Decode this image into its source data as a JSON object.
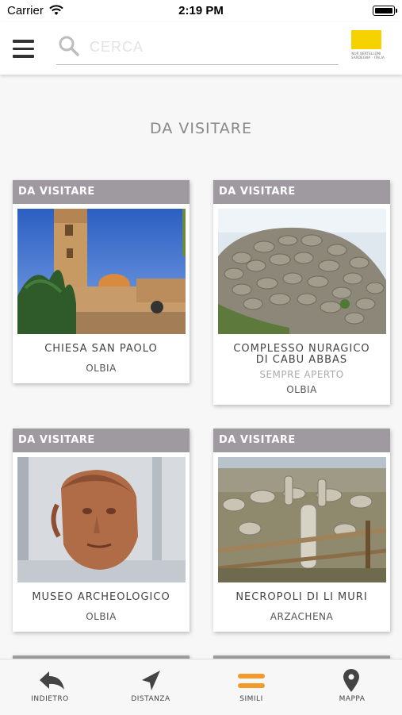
{
  "status_bar": {
    "carrier": "Carrier",
    "time": "2:19 PM"
  },
  "header": {
    "search_placeholder": "CERCA",
    "logo_line1": "NUR BERTELLONI",
    "logo_line2": "SARDEGNA · ITALIA"
  },
  "section_title": "DA VISITARE",
  "cards": [
    {
      "tag": "DA VISITARE",
      "name": "CHIESA SAN PAOLO",
      "hours": "",
      "location": "OLBIA"
    },
    {
      "tag": "DA VISITARE",
      "name": "COMPLESSO NURAGICO DI CABU ABBAS",
      "hours": "SEMPRE APERTO",
      "location": "OLBIA"
    },
    {
      "tag": "DA VISITARE",
      "name": "MUSEO ARCHEOLOGICO",
      "hours": "",
      "location": "OLBIA"
    },
    {
      "tag": "DA VISITARE",
      "name": "NECROPOLI DI LI MURI",
      "hours": "",
      "location": "ARZACHENA"
    }
  ],
  "bottom_nav": [
    {
      "label": "INDIETRO",
      "icon": "back-arrow-icon"
    },
    {
      "label": "DISTANZA",
      "icon": "navigation-arrow-icon"
    },
    {
      "label": "SIMILI",
      "icon": "list-icon"
    },
    {
      "label": "MAPPA",
      "icon": "map-pin-icon"
    }
  ],
  "colors": {
    "tag_bg": "#9f9aa0",
    "active_tab": "#f39a2a",
    "logo": "#f6d200"
  }
}
